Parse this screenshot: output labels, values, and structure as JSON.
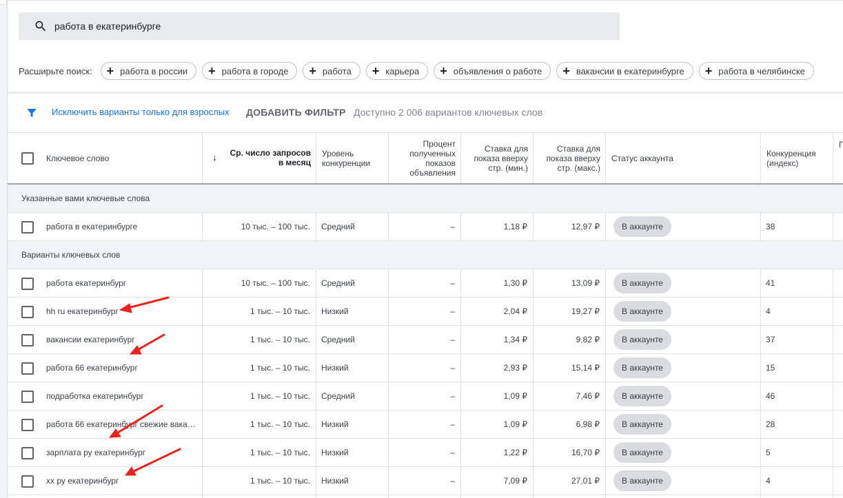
{
  "search": {
    "value": "работа в екатеринбурге",
    "icon": "search-icon"
  },
  "expand": {
    "label": "Расширьте поиск:",
    "chips": [
      "работа в россии",
      "работа в городе",
      "работа",
      "карьера",
      "объявления о работе",
      "вакансии в екатеринбурге",
      "работа в челябинске"
    ]
  },
  "filter": {
    "icon": "filter-icon",
    "exclude_link": "Исключить варианты только для взрослых",
    "add_filter": "ДОБАВИТЬ ФИЛЬТР",
    "available": "Доступно 2 006 вариантов ключевых слов"
  },
  "table": {
    "columns": {
      "keyword": "Ключевое слово",
      "avg_searches": "Ср. число запросов в месяц",
      "competition": "Уровень конкуренции",
      "impr_share": "Процент полученных показов объявления",
      "bid_low": "Ставка для показа вверху стр. (мин.)",
      "bid_high": "Ставка для показа вверху стр. (макс.)",
      "account_status": "Статус аккаунта",
      "competition_index": "Конкуренция (индекс)",
      "extra": "П"
    },
    "sections": {
      "provided": "Указанные вами ключевые слова",
      "ideas": "Варианты ключевых слов"
    },
    "provided_rows": [
      {
        "keyword": "работа в екатеринбурге",
        "searches": "10 тыс. – 100 тыс.",
        "competition": "Средний",
        "impr": "–",
        "low": "1,18 ₽",
        "high": "12,97 ₽",
        "status": "В аккаунте",
        "index": "38"
      }
    ],
    "idea_rows": [
      {
        "keyword": "работа екатеринбург",
        "searches": "10 тыс. – 100 тыс.",
        "competition": "Средний",
        "impr": "–",
        "low": "1,30 ₽",
        "high": "13,09 ₽",
        "status": "В аккаунте",
        "index": "41"
      },
      {
        "keyword": "hh ru екатеринбург",
        "searches": "1 тыс. – 10 тыс.",
        "competition": "Низкий",
        "impr": "–",
        "low": "2,04 ₽",
        "high": "19,27 ₽",
        "status": "В аккаунте",
        "index": "4"
      },
      {
        "keyword": "вакансии екатеринбург",
        "searches": "1 тыс. – 10 тыс.",
        "competition": "Средний",
        "impr": "–",
        "low": "1,34 ₽",
        "high": "9,82 ₽",
        "status": "В аккаунте",
        "index": "37"
      },
      {
        "keyword": "работа 66 екатеринбург",
        "searches": "1 тыс. – 10 тыс.",
        "competition": "Низкий",
        "impr": "–",
        "low": "2,93 ₽",
        "high": "15,14 ₽",
        "status": "В аккаунте",
        "index": "15"
      },
      {
        "keyword": "подработка екатеринбург",
        "searches": "1 тыс. – 10 тыс.",
        "competition": "Средний",
        "impr": "–",
        "low": "1,09 ₽",
        "high": "7,46 ₽",
        "status": "В аккаунте",
        "index": "46"
      },
      {
        "keyword": "работа 66 екатеринбург свежие вака…",
        "searches": "1 тыс. – 10 тыс.",
        "competition": "Низкий",
        "impr": "–",
        "low": "1,09 ₽",
        "high": "6,98 ₽",
        "status": "В аккаунте",
        "index": "28"
      },
      {
        "keyword": "зарплата ру екатеринбург",
        "searches": "1 тыс. – 10 тыс.",
        "competition": "Низкий",
        "impr": "–",
        "low": "1,22 ₽",
        "high": "16,70 ₽",
        "status": "В аккаунте",
        "index": "5"
      },
      {
        "keyword": "хх ру екатеринбург",
        "searches": "1 тыс. – 10 тыс.",
        "competition": "Низкий",
        "impr": "–",
        "low": "7,09 ₽",
        "high": "27,01 ₽",
        "status": "В аккаунте",
        "index": "4"
      }
    ]
  },
  "annotation_color": "#e8231e"
}
